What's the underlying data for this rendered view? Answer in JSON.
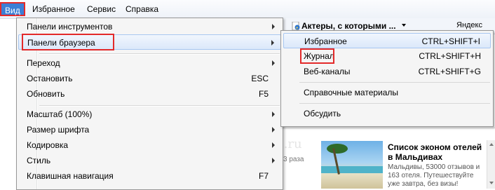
{
  "menubar": {
    "items": [
      "Вид",
      "Избранное",
      "Сервис",
      "Справка"
    ]
  },
  "background": {
    "favorites_bar_item": "Актеры, с которыми ...",
    "yandex": "Яндекс",
    "watermark": "chocho.ru"
  },
  "view_menu": {
    "items": [
      {
        "label": "Панели инструментов",
        "shortcut": "",
        "submenu": true
      },
      {
        "label": "Панели браузера",
        "shortcut": "",
        "submenu": true
      },
      {
        "label": "Переход",
        "shortcut": "",
        "submenu": true
      },
      {
        "label": "Остановить",
        "shortcut": "ESC",
        "submenu": false
      },
      {
        "label": "Обновить",
        "shortcut": "F5",
        "submenu": false
      },
      {
        "label": "Масштаб (100%)",
        "shortcut": "",
        "submenu": true
      },
      {
        "label": "Размер шрифта",
        "shortcut": "",
        "submenu": true
      },
      {
        "label": "Кодировка",
        "shortcut": "",
        "submenu": true
      },
      {
        "label": "Стиль",
        "shortcut": "",
        "submenu": true
      },
      {
        "label": "Клавишная навигация",
        "shortcut": "F7",
        "submenu": false
      }
    ]
  },
  "browser_bars_submenu": {
    "items": [
      {
        "label": "Избранное",
        "shortcut": "CTRL+SHIFT+I"
      },
      {
        "label": "Журнал",
        "shortcut": "CTRL+SHIFT+H"
      },
      {
        "label": "Веб-каналы",
        "shortcut": "CTRL+SHIFT+G"
      },
      {
        "label": "Справочные материалы",
        "shortcut": ""
      },
      {
        "label": "Обсудить",
        "shortcut": ""
      }
    ]
  },
  "page": {
    "count_text": "3 раза",
    "ad_title": "Список эконом отелей в Мальдивах",
    "ad_text": "Мальдивы, 53000 отзывов и 163 отеля. Путешествуйте уже завтра, без визы!"
  },
  "colors": {
    "highlight_red": "#e32a2a",
    "menu_active_blue": "#3c7fd6"
  }
}
